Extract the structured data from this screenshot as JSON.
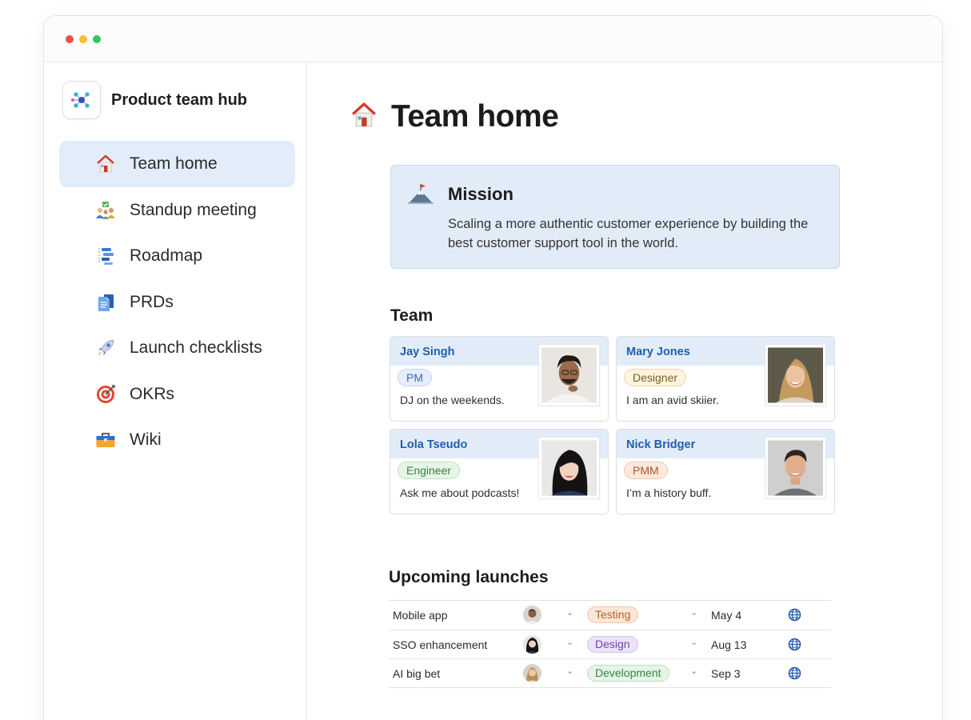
{
  "workspace": {
    "title": "Product team hub",
    "logo_icon": "network-hub-icon"
  },
  "sidebar": {
    "items": [
      {
        "label": "Team home",
        "icon": "house-icon",
        "active": true
      },
      {
        "label": "Standup meeting",
        "icon": "people-meeting-icon",
        "active": false
      },
      {
        "label": "Roadmap",
        "icon": "roadmap-list-icon",
        "active": false
      },
      {
        "label": "PRDs",
        "icon": "documents-icon",
        "active": false
      },
      {
        "label": "Launch checklists",
        "icon": "rocket-icon",
        "active": false
      },
      {
        "label": "OKRs",
        "icon": "target-icon",
        "active": false
      },
      {
        "label": "Wiki",
        "icon": "toolbox-icon",
        "active": false
      }
    ]
  },
  "page": {
    "title": "Team home",
    "icon": "house-icon"
  },
  "mission": {
    "title": "Mission",
    "icon": "mountain-flag-icon",
    "body": "Scaling a more authentic customer experience by building the best customer support tool in the world."
  },
  "team": {
    "heading": "Team",
    "members": [
      {
        "name": "Jay Singh",
        "role": "PM",
        "bio": "DJ on the weekends."
      },
      {
        "name": "Mary Jones",
        "role": "Designer",
        "bio": "I am an avid skiier."
      },
      {
        "name": "Lola Tseudo",
        "role": "Engineer",
        "bio": "Ask me about podcasts!"
      },
      {
        "name": "Nick Bridger",
        "role": "PMM",
        "bio": "I’m a history buff."
      }
    ]
  },
  "launches": {
    "heading": "Upcoming launches",
    "rows": [
      {
        "name": "Mobile app",
        "status": "Testing",
        "date": "May 4"
      },
      {
        "name": "SSO enhancement",
        "status": "Design",
        "date": "Aug 13"
      },
      {
        "name": "AI big bet",
        "status": "Development",
        "date": "Sep 3"
      }
    ]
  },
  "colors": {
    "active_nav_bg": "#e2edf9",
    "callout_bg": "#e2ecf9",
    "member_name": "#1f5fad",
    "link_globe": "#2a5db0"
  }
}
